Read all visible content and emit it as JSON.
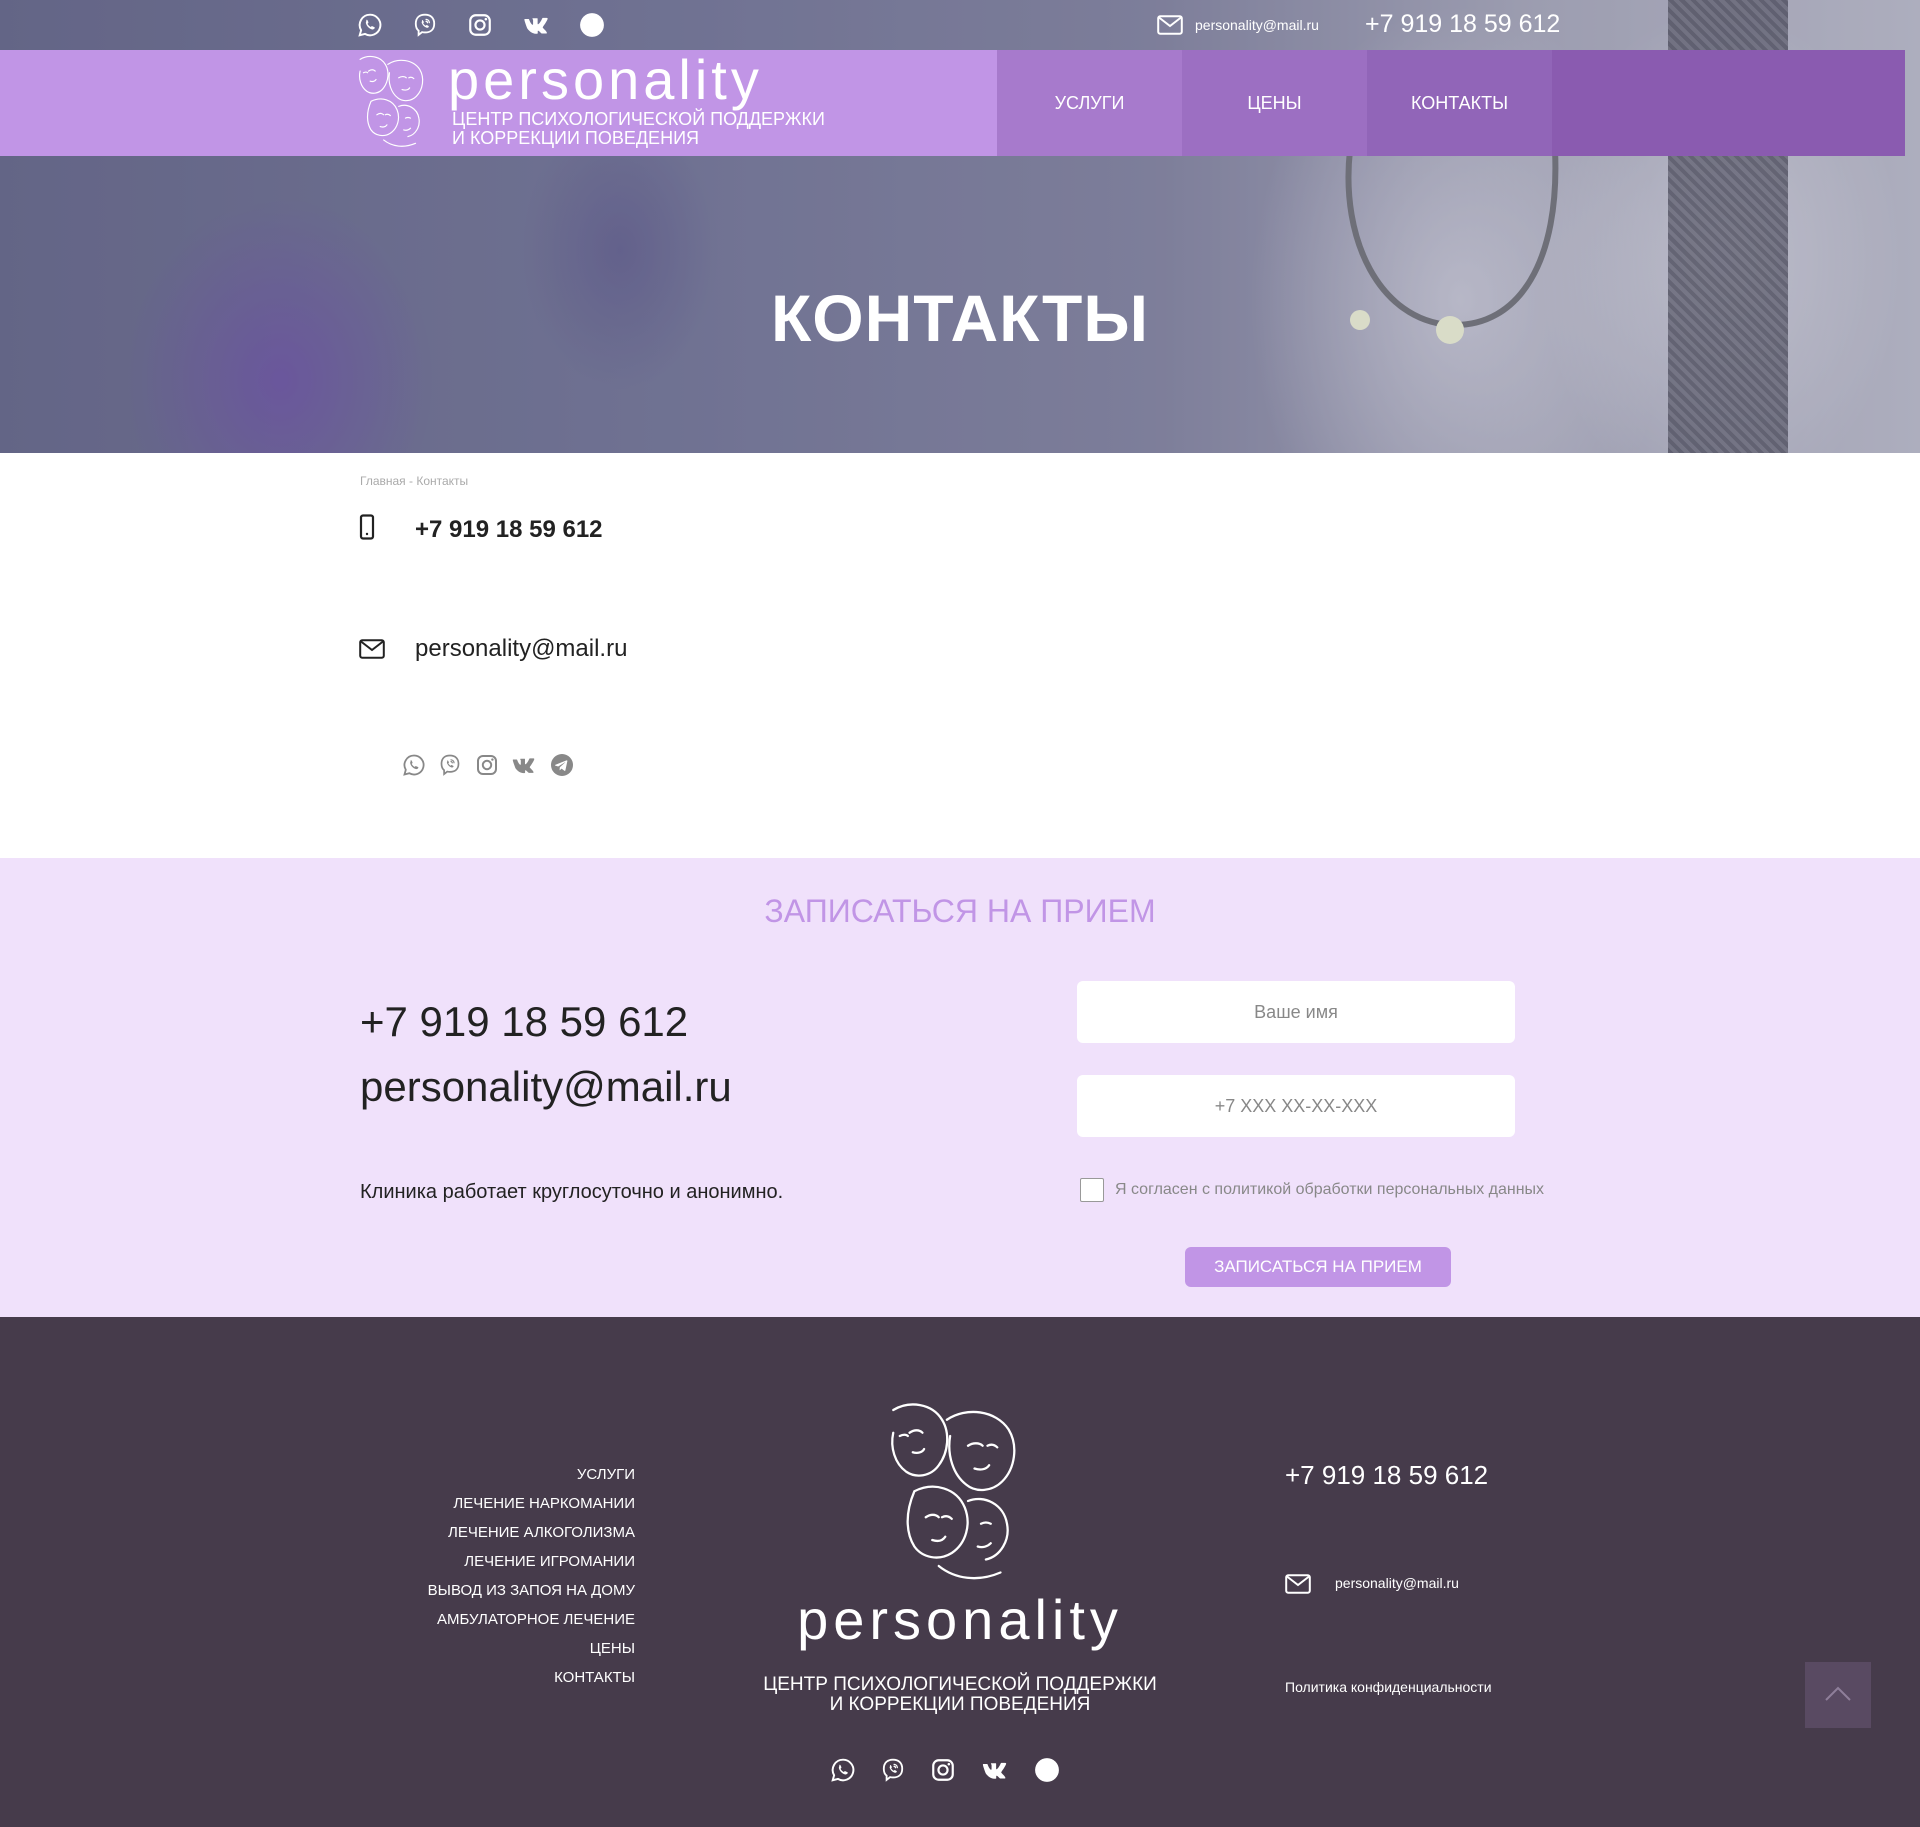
{
  "colors": {
    "accent": "#c195e6",
    "nav_dark": "#8a5bb0",
    "appoint_bg": "#f0e1fb",
    "footer_bg": "#463b4b"
  },
  "topbar": {
    "socials": [
      "whatsapp-icon",
      "viber-icon",
      "instagram-icon",
      "vk-icon",
      "telegram-icon"
    ],
    "email": "personality@mail.ru",
    "phone": "+7 919 18 59 612"
  },
  "logo": {
    "word": "personality",
    "sub_line1": "ЦЕНТР ПСИХОЛОГИЧЕСКОЙ ПОДДЕРЖКИ",
    "sub_line2": "И КОРРЕКЦИИ ПОВЕДЕНИЯ"
  },
  "nav": {
    "items": [
      {
        "label": "УСЛУГИ"
      },
      {
        "label": "ЦЕНЫ"
      },
      {
        "label": "КОНТАКТЫ"
      }
    ]
  },
  "hero": {
    "title": "КОНТАКТЫ"
  },
  "breadcrumb": "Главная - Контакты",
  "contacts": {
    "phone": "+7 919 18 59 612",
    "email": "personality@mail.ru"
  },
  "appointment": {
    "title": "ЗАПИСАТЬСЯ НА ПРИЕМ",
    "phone": "+7 919 18 59 612",
    "email": "personality@mail.ru",
    "note": "Клиника работает круглосуточно и анонимно.",
    "name_placeholder": "Ваше имя",
    "phone_placeholder": "+7 XXX XX-XX-XXX",
    "consent": "Я согласен с политикой обработки персональных данных",
    "button": "ЗАПИСАТЬСЯ НА ПРИЕМ"
  },
  "footer": {
    "menu": [
      "УСЛУГИ",
      "ЛЕЧЕНИЕ НАРКОМАНИИ",
      "ЛЕЧЕНИЕ АЛКОГОЛИЗМА",
      "ЛЕЧЕНИЕ ИГРОМАНИИ",
      "ВЫВОД ИЗ ЗАПОЯ НА ДОМУ",
      "АМБУЛАТОРНОЕ ЛЕЧЕНИЕ",
      "ЦЕНЫ",
      "КОНТАКТЫ"
    ],
    "logo_word": "personality",
    "logo_sub_line1": "ЦЕНТР ПСИХОЛОГИЧЕСКОЙ ПОДДЕРЖКИ",
    "logo_sub_line2": "И КОРРЕКЦИИ ПОВЕДЕНИЯ",
    "phone": "+7 919 18 59 612",
    "email": "personality@mail.ru",
    "policy": "Политика конфиденциальности"
  }
}
